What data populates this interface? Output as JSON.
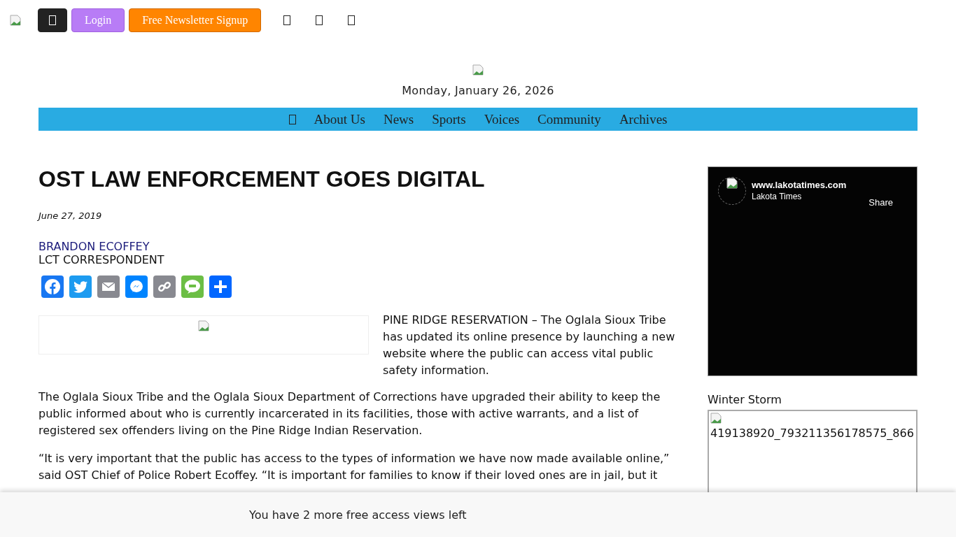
{
  "top_bar": {
    "buttons": [
      {
        "kind": "icon"
      },
      {
        "kind": "login",
        "label": "Login"
      },
      {
        "kind": "signup",
        "label": "Free Newsletter Signup"
      }
    ],
    "social_icons": [
      {
        "kind": "glyph"
      },
      {
        "kind": "glyph"
      },
      {
        "kind": "glyph"
      }
    ]
  },
  "masthead": {
    "date": "Monday, January 26, 2026"
  },
  "nav": {
    "items": [
      {
        "kind": "home"
      },
      {
        "kind": "link",
        "label": "About Us"
      },
      {
        "kind": "link",
        "label": "News"
      },
      {
        "kind": "link",
        "label": "Sports"
      },
      {
        "kind": "link",
        "label": "Voices"
      },
      {
        "kind": "link",
        "label": "Community"
      },
      {
        "kind": "link",
        "label": "Archives"
      }
    ]
  },
  "article": {
    "title": "OST LAW ENFORCEMENT GOES DIGITAL",
    "date": "June 27, 2019",
    "author": "BRANDON ECOFFEY",
    "role": "LCT CORRESPONDENT",
    "share": [
      {
        "kind": "facebook"
      },
      {
        "kind": "twitter"
      },
      {
        "kind": "email"
      },
      {
        "kind": "messenger"
      },
      {
        "kind": "copy"
      },
      {
        "kind": "sms"
      },
      {
        "kind": "share"
      }
    ],
    "lead": "PINE RIDGE RESERVATION – The Oglala Sioux Tribe has updated its online presence by launching a new website where the public can access vital public safety information.",
    "paragraphs": [
      "The Oglala Sioux Tribe and the Oglala Sioux Department of Corrections have upgraded their ability to keep the public informed about who is currently incarcerated in its facilities, those with active warrants, and a list of registered sex offenders living on the Pine Ridge Indian Reservation.",
      "“It is very important that the public has access to the types of information we have now made available online,” said OST Chief of Police Robert Ecoffey. “It is important for families to know if their loved ones are in jail, but it"
    ]
  },
  "sidebar": {
    "video": {
      "site": "www.lakotatimes.com",
      "page": "Lakota Times",
      "share": "Share"
    },
    "widget_title": "Winter Storm",
    "image_alt": "419138920_793211356178575_866"
  },
  "banner": {
    "text": "You have 2 more free access views left"
  }
}
